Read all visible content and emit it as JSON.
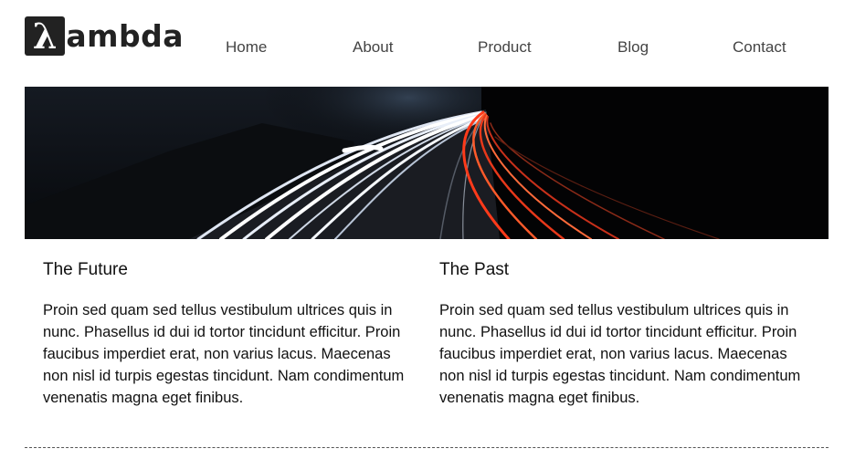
{
  "logo": {
    "mark": "λ",
    "text": "ambda"
  },
  "nav": {
    "items": [
      {
        "label": "Home"
      },
      {
        "label": "About"
      },
      {
        "label": "Product"
      },
      {
        "label": "Blog"
      },
      {
        "label": "Contact"
      }
    ]
  },
  "hero": {
    "icon": "highway-light-trails-image"
  },
  "sections": [
    {
      "title": "The Future",
      "body": "Proin sed quam sed tellus vestibulum ultrices quis in nunc. Phasellus id dui id tortor tincidunt efficitur. Proin faucibus imperdiet erat, non varius lacus. Maecenas non nisl id turpis egestas tincidunt. Nam condimentum venenatis magna eget finibus."
    },
    {
      "title": "The Past",
      "body": "Proin sed quam sed tellus vestibulum ultrices quis in nunc. Phasellus id dui id tortor tincidunt efficitur. Proin faucibus imperdiet erat, non varius lacus. Maecenas non nisl id turpis egestas tincidunt. Nam condimentum venenatis magna eget finibus."
    }
  ],
  "colors": {
    "logo_bg": "#222222",
    "nav_text": "#444444",
    "hero_bg": "#050608"
  }
}
